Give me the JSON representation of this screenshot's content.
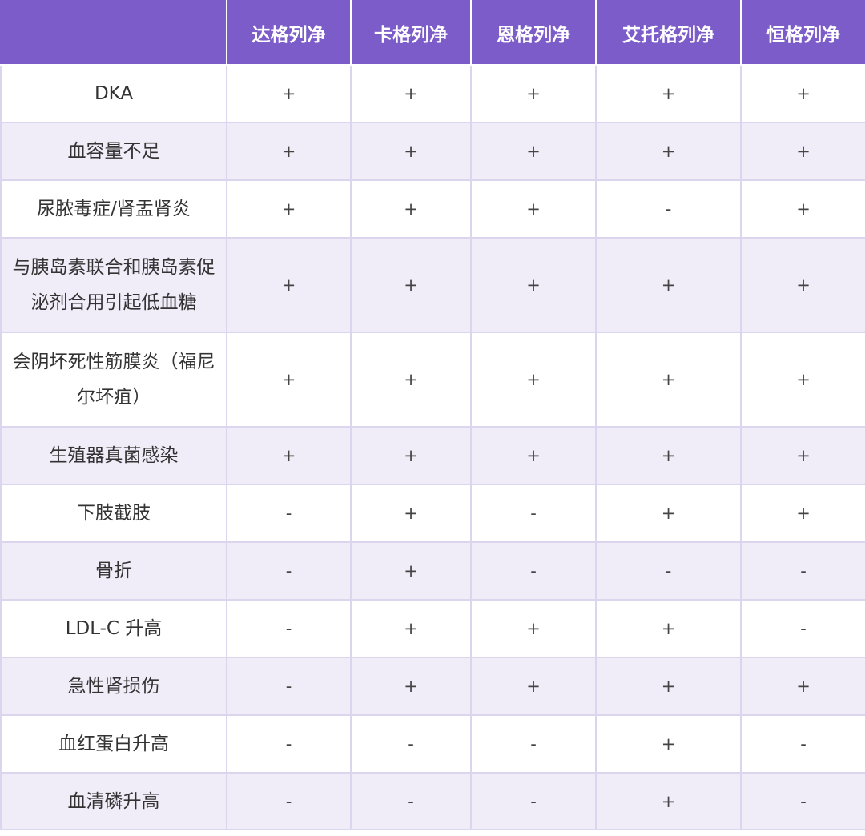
{
  "table": {
    "headers": [
      "",
      "达格列净",
      "卡格列净",
      "恩格列净",
      "艾托格列净",
      "恒格列净"
    ],
    "rows": [
      {
        "label": "DKA",
        "values": [
          "+",
          "+",
          "+",
          "+",
          "+"
        ]
      },
      {
        "label": "血容量不足",
        "values": [
          "+",
          "+",
          "+",
          "+",
          "+"
        ]
      },
      {
        "label": "尿脓毒症/肾盂肾炎",
        "values": [
          "+",
          "+",
          "+",
          "-",
          "+"
        ]
      },
      {
        "label": "与胰岛素联合和胰岛素促泌剂合用引起低血糖",
        "values": [
          "+",
          "+",
          "+",
          "+",
          "+"
        ]
      },
      {
        "label": "会阴坏死性筋膜炎（福尼尔坏疽）",
        "values": [
          "+",
          "+",
          "+",
          "+",
          "+"
        ]
      },
      {
        "label": "生殖器真菌感染",
        "values": [
          "+",
          "+",
          "+",
          "+",
          "+"
        ]
      },
      {
        "label": "下肢截肢",
        "values": [
          "-",
          "+",
          "-",
          "+",
          "+"
        ]
      },
      {
        "label": "骨折",
        "values": [
          "-",
          "+",
          "-",
          "-",
          "-"
        ]
      },
      {
        "label": "LDL-C 升高",
        "values": [
          "-",
          "+",
          "+",
          "+",
          "-"
        ]
      },
      {
        "label": "急性肾损伤",
        "values": [
          "-",
          "+",
          "+",
          "+",
          "+"
        ]
      },
      {
        "label": "血红蛋白升高",
        "values": [
          "-",
          "-",
          "-",
          "+",
          "-"
        ]
      },
      {
        "label": "血清磷升高",
        "values": [
          "-",
          "-",
          "-",
          "+",
          "-"
        ]
      }
    ]
  }
}
